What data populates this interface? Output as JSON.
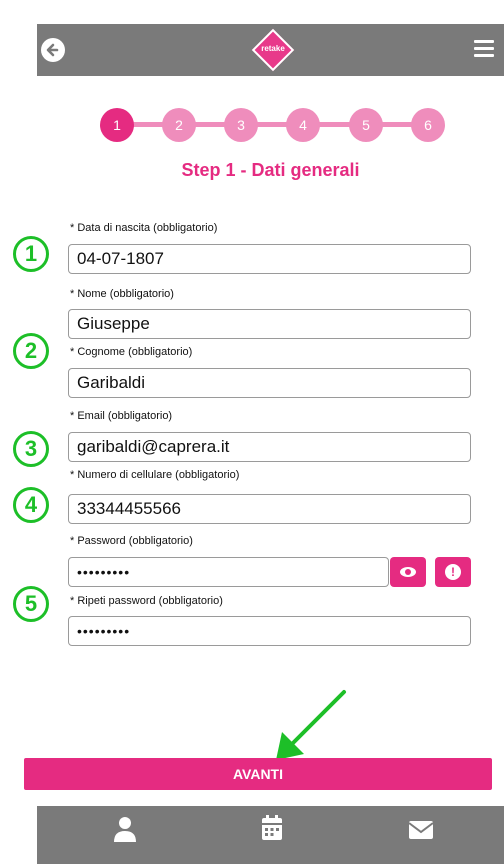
{
  "header": {
    "logo_text": "retake"
  },
  "steps": [
    "1",
    "2",
    "3",
    "4",
    "5",
    "6"
  ],
  "step_title": "Step 1 - Dati generali",
  "fields": {
    "birth_label": "* Data di nascita (obbligatorio)",
    "birth_value": "04-07-1807",
    "name_label": "* Nome (obbligatorio)",
    "name_value": "Giuseppe",
    "surname_label": "* Cognome (obbligatorio)",
    "surname_value": "Garibaldi",
    "email_label": "* Email (obbligatorio)",
    "email_value": "garibaldi@caprera.it",
    "phone_label": "* Numero di cellulare (obbligatorio)",
    "phone_value": "33344455566",
    "password_label": "* Password (obbligatorio)",
    "password_value": "•••••••••",
    "repeat_label": "* Ripeti password (obbligatorio)",
    "repeat_value": "•••••••••"
  },
  "annotations": [
    "1",
    "2",
    "3",
    "4",
    "5"
  ],
  "submit_label": "AVANTI",
  "colors": {
    "accent": "#e52b81",
    "accent_light": "#ef8dbc",
    "annotation": "#1dbf28",
    "bar": "#7a7a7a"
  },
  "icons": [
    "back-arrow-icon",
    "menu-icon",
    "user-icon",
    "calendar-icon",
    "envelope-icon",
    "eye-icon",
    "exclamation-icon"
  ]
}
